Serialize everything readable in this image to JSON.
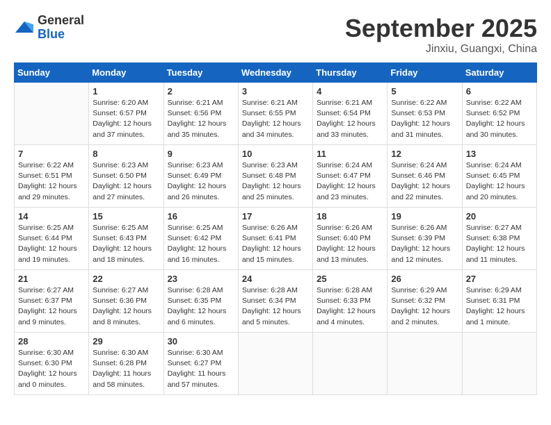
{
  "header": {
    "logo_general": "General",
    "logo_blue": "Blue",
    "month": "September 2025",
    "location": "Jinxiu, Guangxi, China"
  },
  "days_of_week": [
    "Sunday",
    "Monday",
    "Tuesday",
    "Wednesday",
    "Thursday",
    "Friday",
    "Saturday"
  ],
  "weeks": [
    [
      {
        "day": "",
        "info": ""
      },
      {
        "day": "1",
        "info": "Sunrise: 6:20 AM\nSunset: 6:57 PM\nDaylight: 12 hours\nand 37 minutes."
      },
      {
        "day": "2",
        "info": "Sunrise: 6:21 AM\nSunset: 6:56 PM\nDaylight: 12 hours\nand 35 minutes."
      },
      {
        "day": "3",
        "info": "Sunrise: 6:21 AM\nSunset: 6:55 PM\nDaylight: 12 hours\nand 34 minutes."
      },
      {
        "day": "4",
        "info": "Sunrise: 6:21 AM\nSunset: 6:54 PM\nDaylight: 12 hours\nand 33 minutes."
      },
      {
        "day": "5",
        "info": "Sunrise: 6:22 AM\nSunset: 6:53 PM\nDaylight: 12 hours\nand 31 minutes."
      },
      {
        "day": "6",
        "info": "Sunrise: 6:22 AM\nSunset: 6:52 PM\nDaylight: 12 hours\nand 30 minutes."
      }
    ],
    [
      {
        "day": "7",
        "info": "Sunrise: 6:22 AM\nSunset: 6:51 PM\nDaylight: 12 hours\nand 29 minutes."
      },
      {
        "day": "8",
        "info": "Sunrise: 6:23 AM\nSunset: 6:50 PM\nDaylight: 12 hours\nand 27 minutes."
      },
      {
        "day": "9",
        "info": "Sunrise: 6:23 AM\nSunset: 6:49 PM\nDaylight: 12 hours\nand 26 minutes."
      },
      {
        "day": "10",
        "info": "Sunrise: 6:23 AM\nSunset: 6:48 PM\nDaylight: 12 hours\nand 25 minutes."
      },
      {
        "day": "11",
        "info": "Sunrise: 6:24 AM\nSunset: 6:47 PM\nDaylight: 12 hours\nand 23 minutes."
      },
      {
        "day": "12",
        "info": "Sunrise: 6:24 AM\nSunset: 6:46 PM\nDaylight: 12 hours\nand 22 minutes."
      },
      {
        "day": "13",
        "info": "Sunrise: 6:24 AM\nSunset: 6:45 PM\nDaylight: 12 hours\nand 20 minutes."
      }
    ],
    [
      {
        "day": "14",
        "info": "Sunrise: 6:25 AM\nSunset: 6:44 PM\nDaylight: 12 hours\nand 19 minutes."
      },
      {
        "day": "15",
        "info": "Sunrise: 6:25 AM\nSunset: 6:43 PM\nDaylight: 12 hours\nand 18 minutes."
      },
      {
        "day": "16",
        "info": "Sunrise: 6:25 AM\nSunset: 6:42 PM\nDaylight: 12 hours\nand 16 minutes."
      },
      {
        "day": "17",
        "info": "Sunrise: 6:26 AM\nSunset: 6:41 PM\nDaylight: 12 hours\nand 15 minutes."
      },
      {
        "day": "18",
        "info": "Sunrise: 6:26 AM\nSunset: 6:40 PM\nDaylight: 12 hours\nand 13 minutes."
      },
      {
        "day": "19",
        "info": "Sunrise: 6:26 AM\nSunset: 6:39 PM\nDaylight: 12 hours\nand 12 minutes."
      },
      {
        "day": "20",
        "info": "Sunrise: 6:27 AM\nSunset: 6:38 PM\nDaylight: 12 hours\nand 11 minutes."
      }
    ],
    [
      {
        "day": "21",
        "info": "Sunrise: 6:27 AM\nSunset: 6:37 PM\nDaylight: 12 hours\nand 9 minutes."
      },
      {
        "day": "22",
        "info": "Sunrise: 6:27 AM\nSunset: 6:36 PM\nDaylight: 12 hours\nand 8 minutes."
      },
      {
        "day": "23",
        "info": "Sunrise: 6:28 AM\nSunset: 6:35 PM\nDaylight: 12 hours\nand 6 minutes."
      },
      {
        "day": "24",
        "info": "Sunrise: 6:28 AM\nSunset: 6:34 PM\nDaylight: 12 hours\nand 5 minutes."
      },
      {
        "day": "25",
        "info": "Sunrise: 6:28 AM\nSunset: 6:33 PM\nDaylight: 12 hours\nand 4 minutes."
      },
      {
        "day": "26",
        "info": "Sunrise: 6:29 AM\nSunset: 6:32 PM\nDaylight: 12 hours\nand 2 minutes."
      },
      {
        "day": "27",
        "info": "Sunrise: 6:29 AM\nSunset: 6:31 PM\nDaylight: 12 hours\nand 1 minute."
      }
    ],
    [
      {
        "day": "28",
        "info": "Sunrise: 6:30 AM\nSunset: 6:30 PM\nDaylight: 12 hours\nand 0 minutes."
      },
      {
        "day": "29",
        "info": "Sunrise: 6:30 AM\nSunset: 6:28 PM\nDaylight: 11 hours\nand 58 minutes."
      },
      {
        "day": "30",
        "info": "Sunrise: 6:30 AM\nSunset: 6:27 PM\nDaylight: 11 hours\nand 57 minutes."
      },
      {
        "day": "",
        "info": ""
      },
      {
        "day": "",
        "info": ""
      },
      {
        "day": "",
        "info": ""
      },
      {
        "day": "",
        "info": ""
      }
    ]
  ]
}
